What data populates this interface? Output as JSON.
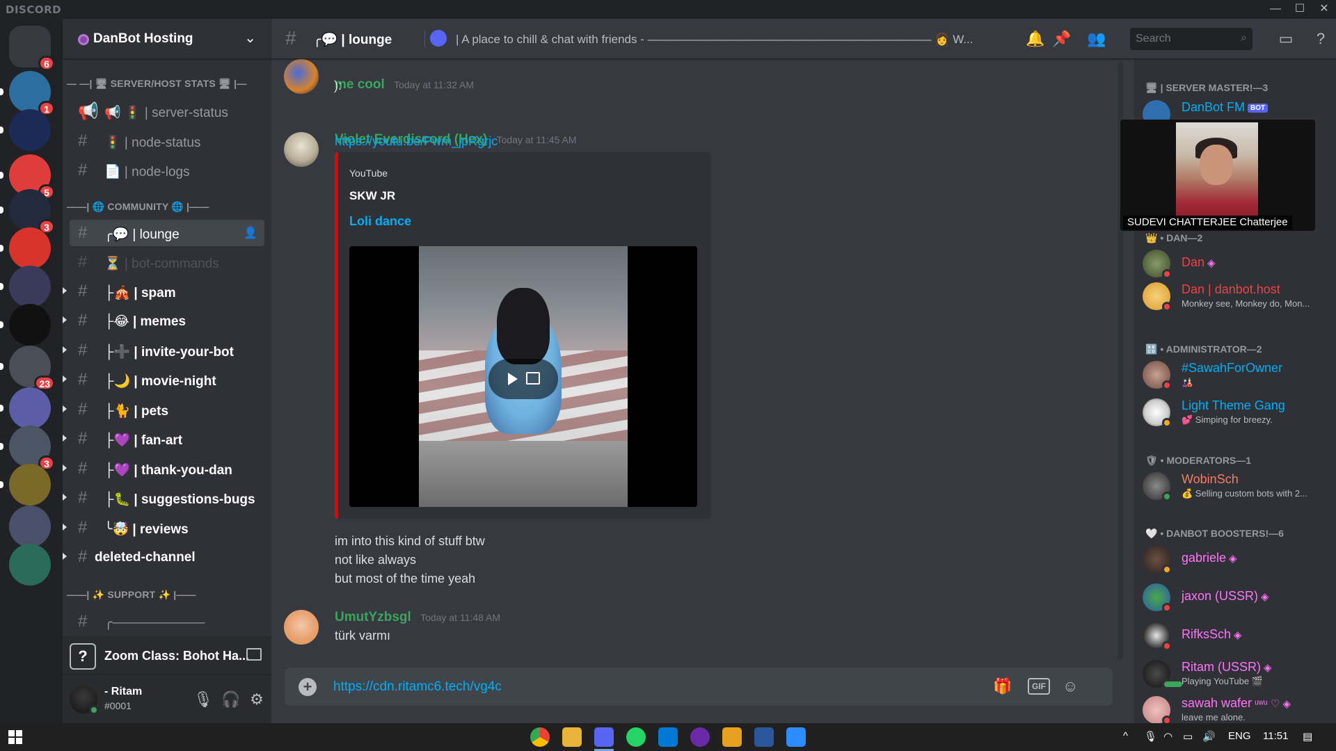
{
  "window": {
    "brand": "DISCORD",
    "controls": {
      "minimize": "—",
      "maximize": "☐",
      "close": "✕"
    }
  },
  "servers": [
    {
      "name": "home",
      "badge": "6",
      "color": "#36393f"
    },
    {
      "name": "server-2",
      "badge": "1",
      "color": "#2c6e9e"
    },
    {
      "name": "server-3",
      "badge": "",
      "color": "#1c2a58"
    },
    {
      "name": "server-4",
      "badge": "5",
      "color": "#e03c3c"
    },
    {
      "name": "server-5",
      "badge": "3",
      "color": "#232a3e"
    },
    {
      "name": "server-6",
      "badge": "",
      "color": "#d8342c"
    },
    {
      "name": "server-7",
      "badge": "",
      "color": "#3a3a5a"
    },
    {
      "name": "server-8",
      "badge": "",
      "color": "#111111"
    },
    {
      "name": "server-9",
      "badge": "23",
      "color": "#4a4f57"
    },
    {
      "name": "server-10",
      "badge": "",
      "color": "#5b5ea6"
    },
    {
      "name": "server-11",
      "badge": "3",
      "color": "#4b5563"
    },
    {
      "name": "server-12",
      "badge": "",
      "color": "#7a6a2a"
    },
    {
      "name": "server-13",
      "badge": "",
      "color": "#4a4f6a"
    },
    {
      "name": "server-14",
      "badge": "",
      "color": "#2b6b5a"
    }
  ],
  "guild": {
    "name": "DanBot Hosting",
    "chevron": "⌄"
  },
  "categories": {
    "stats": "— —| 🖥 SERVER/HOST STATS 🖥 |—",
    "community": "——| 🌐 COMMUNITY 🌐 |——",
    "support": "——| ✨ SUPPORT ✨ |——"
  },
  "channels": [
    {
      "label": "📢 🚦 | server-status",
      "hash": "📢",
      "state": "normal"
    },
    {
      "label": "🚦 | node-status",
      "hash": "#",
      "state": "normal"
    },
    {
      "label": "📄 | node-logs",
      "hash": "#",
      "state": "normal"
    },
    {
      "label": "╭💬 | lounge",
      "hash": "#",
      "state": "active"
    },
    {
      "label": "⏳ | bot-commands",
      "hash": "#",
      "state": "muted"
    },
    {
      "label": "├🎪 | spam",
      "hash": "#",
      "state": "unread"
    },
    {
      "label": "├😂 | memes",
      "hash": "#",
      "state": "unread"
    },
    {
      "label": "├➕ | invite-your-bot",
      "hash": "#",
      "state": "unread"
    },
    {
      "label": "├🌙 | movie-night",
      "hash": "#",
      "state": "unread"
    },
    {
      "label": "├🐈 | pets",
      "hash": "#",
      "state": "unread"
    },
    {
      "label": "├💜 | fan-art",
      "hash": "#",
      "state": "unread"
    },
    {
      "label": "├💜 | thank-you-dan",
      "hash": "#",
      "state": "unread"
    },
    {
      "label": "├🐛 | suggestions-bugs",
      "hash": "#",
      "state": "unread"
    },
    {
      "label": "╰🤯 | reviews",
      "hash": "#",
      "state": "unread"
    },
    {
      "label": "deleted-channel",
      "hash": "#",
      "state": "unread-noemoji"
    },
    {
      "label": "╭———————",
      "hash": "#",
      "state": "normal"
    }
  ],
  "voice": {
    "q": "?",
    "title": "Zoom Class: Bohot Ha..."
  },
  "user": {
    "name": "- Ritam",
    "tag": "#0001"
  },
  "topbar": {
    "channel": "╭💬 | lounge",
    "topic": "| A place to chill & chat with friends - ———————————————————————— 👩 W...",
    "search_placeholder": "Search"
  },
  "messages": {
    "m1": {
      "author": "me cool",
      "time": "Today at 11:32 AM",
      "text": "):",
      "color": "#3ba55d"
    },
    "m2": {
      "author": "Violet Everdiscord (Hex)",
      "time": "Today at 11:45 AM",
      "link": "https://youtu.be/Pwm_jpRgrjc",
      "color": "#3ba55d"
    },
    "embed": {
      "provider": "YouTube",
      "author": "SKW JR",
      "title": "Loli dance"
    },
    "after": [
      "im into this kind of stuff btw",
      "not like always",
      "but most of the time yeah"
    ],
    "m3": {
      "author": "UmutYzbsgl",
      "time": "Today at 11:48 AM",
      "text": "türk varmı",
      "color": "#3ba55d"
    }
  },
  "composer": {
    "text": "https://cdn.ritamc6.tech/vg4c"
  },
  "members": {
    "roles": {
      "master": "🖥 | SERVER MASTER!—3",
      "dan": "👑 • DAN—2",
      "admin": "🔠 • ADMINISTRATOR—2",
      "mods": "🛡 • MODERATORS—1",
      "boosters": "🤍 • DANBOT BOOSTERS!—6"
    },
    "list": [
      {
        "name": "DanBot FM",
        "sub": "",
        "color": "#00aff4",
        "bot": "BOT"
      },
      {
        "name": "Dan",
        "sub": "",
        "color": "#ed4245",
        "boost": "◈"
      },
      {
        "name": "Dan | danbot.host",
        "sub": "Monkey see, Monkey do, Mon...",
        "color": "#ed4245"
      },
      {
        "name": "#SawahForOwner",
        "sub": "🎎",
        "color": "#00aff4"
      },
      {
        "name": "Light Theme Gang",
        "sub": "💕 Simping for breezy.",
        "color": "#00aff4"
      },
      {
        "name": "WobinSch",
        "sub": "💰 Selling custom bots with 2...",
        "color": "#f47b67"
      },
      {
        "name": "gabriele",
        "sub": "",
        "color": "#ff73fa",
        "boost": "◈"
      },
      {
        "name": "jaxon (USSR)",
        "sub": "",
        "color": "#ff73fa",
        "boost": "◈"
      },
      {
        "name": "RifksSch",
        "sub": "",
        "color": "#ff73fa",
        "boost": "◈"
      },
      {
        "name": "Ritam (USSR)",
        "sub": "Playing YouTube 🎬",
        "color": "#ff73fa",
        "boost": "◈"
      },
      {
        "name": "sawah wafer",
        "sub": "leave me alone.",
        "color": "#ff73fa",
        "boost": "ᵘʷᵘ ♡ ◈"
      }
    ]
  },
  "camera": {
    "caption": "SUDEVI CHATTERJEE Chatterjee"
  },
  "taskbar": {
    "lang": "ENG",
    "clock": "11:51"
  }
}
